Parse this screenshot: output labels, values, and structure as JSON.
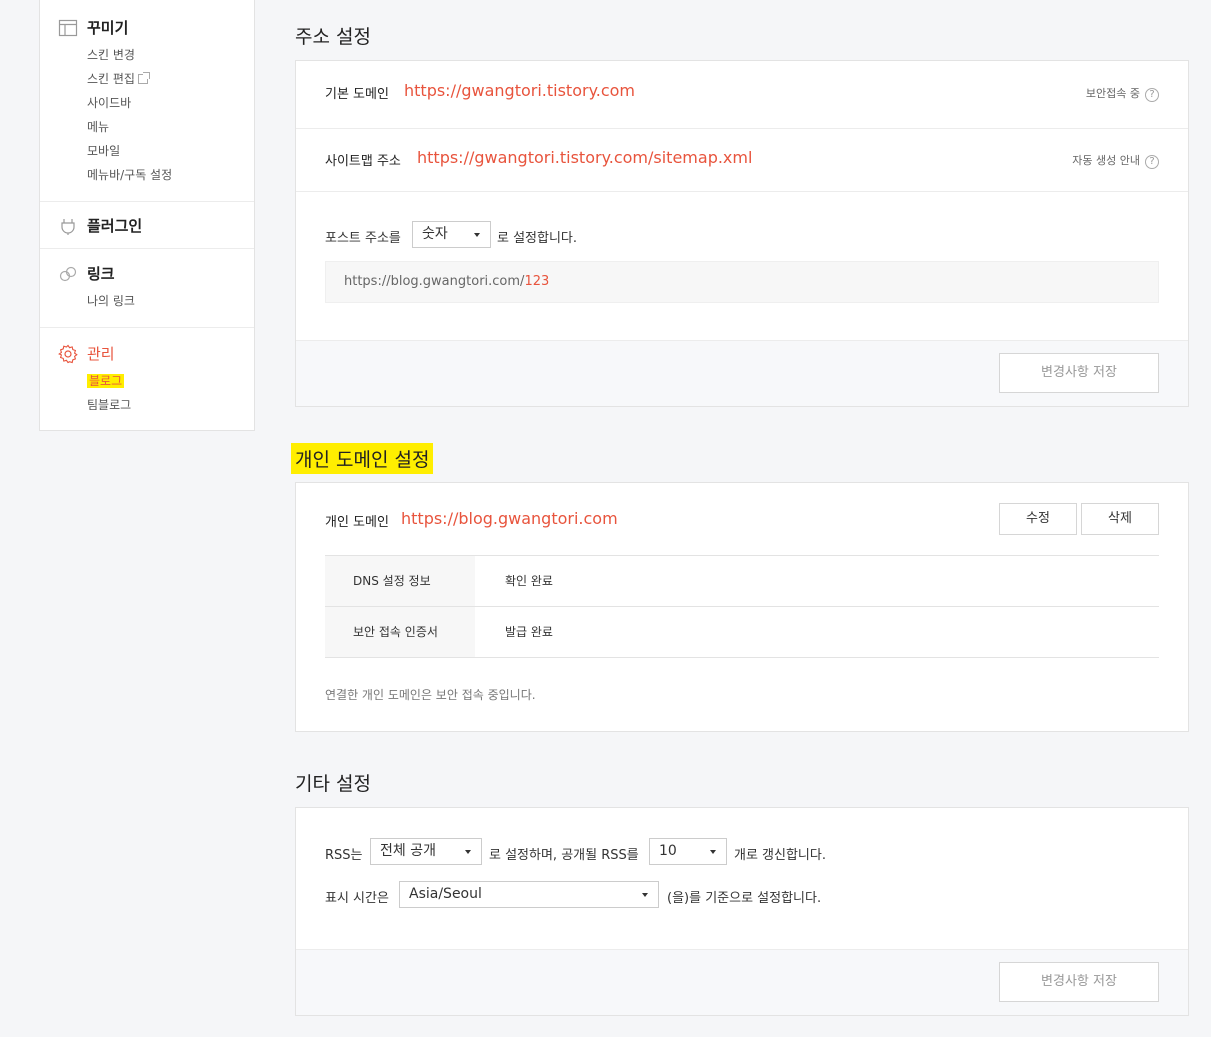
{
  "sidebar": {
    "decorate": {
      "title": "꾸미기",
      "items": [
        "스킨 변경",
        "스킨 편집",
        "사이드바",
        "메뉴",
        "모바일",
        "메뉴바/구독 설정"
      ]
    },
    "plugin": {
      "title": "플러그인"
    },
    "link": {
      "title": "링크",
      "items": [
        "나의 링크"
      ]
    },
    "manage": {
      "title": "관리",
      "items": [
        "블로그",
        "팀블로그"
      ]
    }
  },
  "address": {
    "title": "주소 설정",
    "default_domain_label": "기본 도메인",
    "default_domain_url": "https://gwangtori.tistory.com",
    "secure_help": "보안접속 중",
    "sitemap_label": "사이트맵 주소",
    "sitemap_url": "https://gwangtori.tistory.com/sitemap.xml",
    "sitemap_help": "자동 생성 안내",
    "post_prefix": "포스트 주소를",
    "post_select": "숫자",
    "post_suffix": "로 설정합니다.",
    "preview_base": "https://blog.gwangtori.com/",
    "preview_num": "123",
    "save_label": "변경사항 저장"
  },
  "custom_domain": {
    "title": "개인 도메인 설정",
    "label": "개인 도메인",
    "url": "https://blog.gwangtori.com",
    "edit_label": "수정",
    "delete_label": "삭제",
    "rows": [
      {
        "key": "DNS 설정 정보",
        "value": "확인 완료"
      },
      {
        "key": "보안 접속 인증서",
        "value": "발급 완료"
      }
    ],
    "note": "연결한 개인 도메인은 보안 접속 중입니다."
  },
  "etc": {
    "title": "기타 설정",
    "rss_prefix": "RSS는",
    "rss_select": "전체 공개",
    "rss_mid": "로 설정하며, 공개될 RSS를",
    "rss_count": "10",
    "rss_suffix": "개로 갱신합니다.",
    "tz_prefix": "표시 시간은",
    "tz_select": "Asia/Seoul",
    "tz_suffix": "(을)를 기준으로 설정합니다.",
    "save_label": "변경사항 저장"
  },
  "colors": {
    "accent": "#e8543d",
    "highlight": "#ffee00"
  }
}
